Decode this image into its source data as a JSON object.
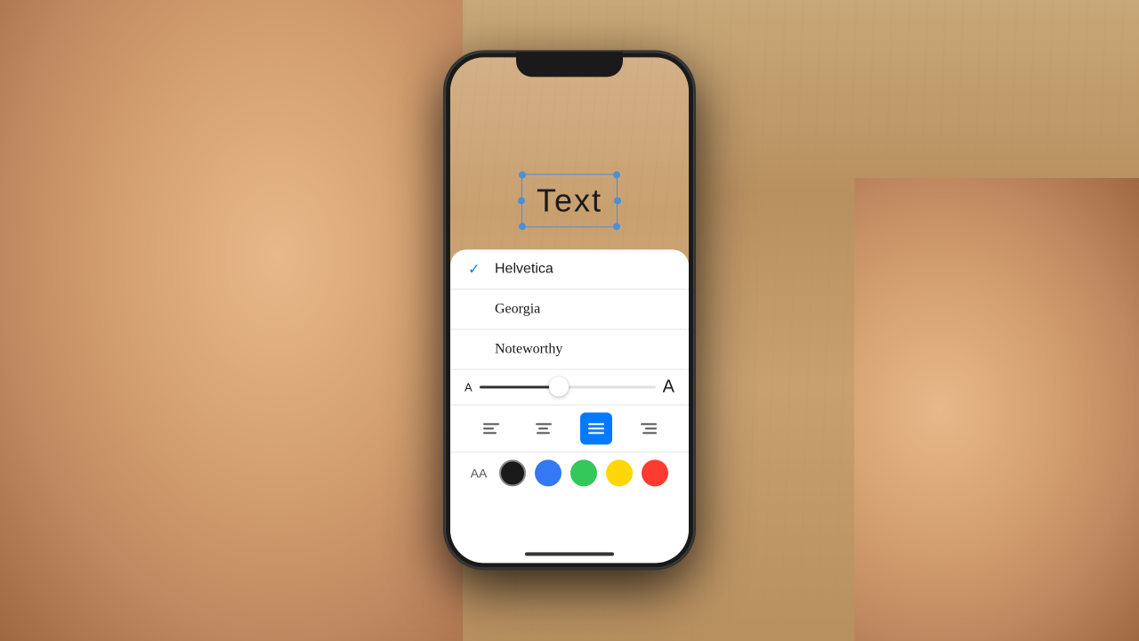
{
  "background": {
    "color": "#b8905a"
  },
  "phone": {
    "canvas": {
      "text": "Text"
    },
    "font_panel": {
      "fonts": [
        {
          "name": "Helvetica",
          "selected": true,
          "class": "helvetica"
        },
        {
          "name": "Georgia",
          "selected": false,
          "class": "georgia"
        },
        {
          "name": "Noteworthy",
          "selected": false,
          "class": "noteworthy"
        }
      ],
      "size_label_small": "A",
      "size_label_large": "A",
      "alignment_options": [
        "left",
        "center",
        "justify",
        "right"
      ],
      "active_alignment": "justify",
      "colors": [
        {
          "name": "black",
          "hex": "#1a1a1a"
        },
        {
          "name": "blue",
          "hex": "#3478F6"
        },
        {
          "name": "green",
          "hex": "#34C759"
        },
        {
          "name": "yellow",
          "hex": "#FFD60A"
        },
        {
          "name": "red",
          "hex": "#FF3B30"
        }
      ],
      "aa_label": "AA"
    }
  }
}
